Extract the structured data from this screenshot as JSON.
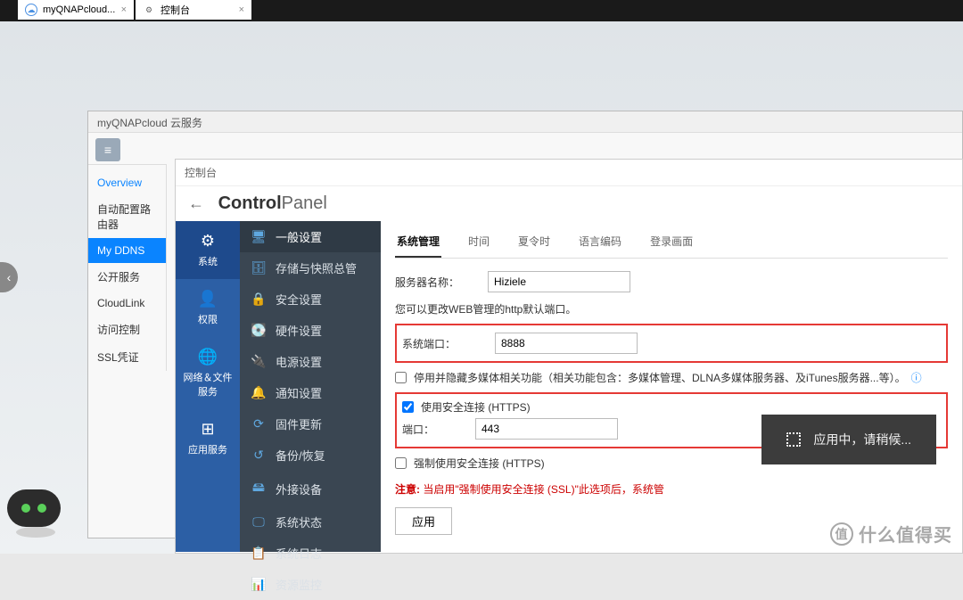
{
  "tabs": [
    {
      "label": "myQNAPcloud...",
      "icon": "cloud"
    },
    {
      "label": "控制台",
      "icon": "gear"
    }
  ],
  "cloud_window": {
    "title": "myQNAPcloud 云服务",
    "sidebar": [
      "Overview",
      "自动配置路由器",
      "My DDNS",
      "公开服务",
      "CloudLink",
      "访问控制",
      "SSL凭证"
    ],
    "active_idx": 2,
    "overview_idx": 0
  },
  "cp": {
    "breadcrumb": "控制台",
    "title_bold": "Control",
    "title_thin": "Panel",
    "back": "←",
    "nav": [
      "系统",
      "权限",
      "网络＆文件服务",
      "应用服务"
    ],
    "nav_active": 0,
    "menu": [
      {
        "icon": "🖥",
        "label": "一般设置"
      },
      {
        "icon": "🗄",
        "label": "存储与快照总管"
      },
      {
        "icon": "🔒",
        "label": "安全设置"
      },
      {
        "icon": "💽",
        "label": "硬件设置"
      },
      {
        "icon": "🔌",
        "label": "电源设置"
      },
      {
        "icon": "🔔",
        "label": "通知设置"
      },
      {
        "icon": "⟳",
        "label": "固件更新"
      },
      {
        "icon": "↺",
        "label": "备份/恢复"
      },
      {
        "icon": "🖴",
        "label": "外接设备"
      },
      {
        "icon": "🖵",
        "label": "系统状态"
      },
      {
        "icon": "📋",
        "label": "系统日志"
      },
      {
        "icon": "📊",
        "label": "资源监控"
      }
    ],
    "menu_active": 0,
    "content_tabs": [
      "系统管理",
      "时间",
      "夏令时",
      "语言编码",
      "登录画面"
    ],
    "content_tab_active": 0,
    "server_name_label": "服务器名称：",
    "server_name": "Hiziele",
    "http_note": "您可以更改WEB管理的http默认端口。",
    "sys_port_label": "系统端口：",
    "sys_port": "8888",
    "cb_disable_media": "停用并隐藏多媒体相关功能（相关功能包含：多媒体管理、DLNA多媒体服务器、及iTunes服务器...等）。",
    "cb_https_label": "使用安全连接 (HTTPS)",
    "port_label": "端口：",
    "https_port": "443",
    "cb_force_https": "强制使用安全连接 (HTTPS)",
    "warning_bold": "注意:",
    "warning_text": " 当启用\"强制使用安全连接 (SSL)\"此选项后，系统管",
    "apply": "应用"
  },
  "toast": "应用中，请稍候...",
  "watermark": "什么值得买"
}
